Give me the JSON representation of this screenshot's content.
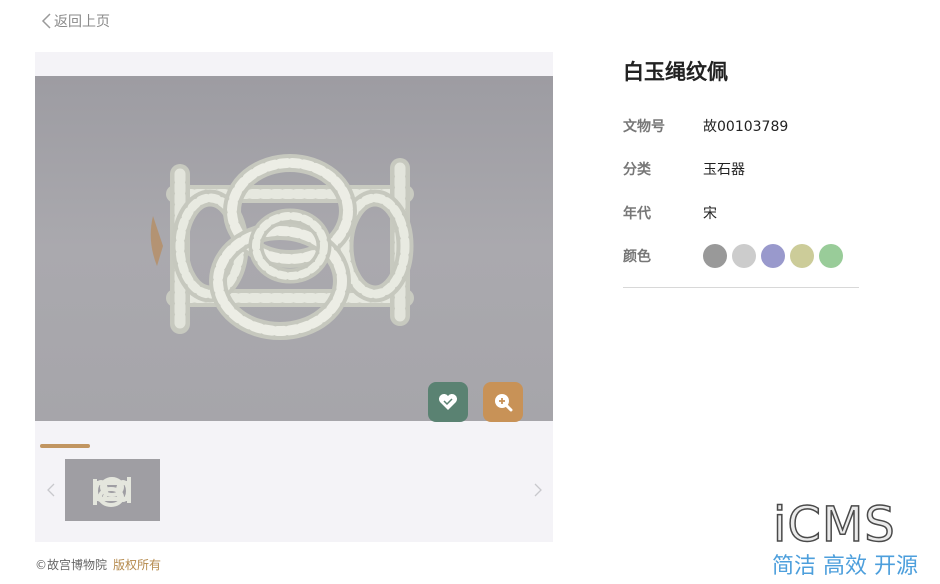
{
  "nav": {
    "back_label": "返回上页"
  },
  "artifact": {
    "title": "白玉绳纹佩",
    "fields": [
      {
        "label": "文物号",
        "value": "故00103789"
      },
      {
        "label": "分类",
        "value": "玉石器"
      },
      {
        "label": "年代",
        "value": "宋"
      }
    ],
    "color_label": "颜色",
    "colors": [
      "#999999",
      "#cccccc",
      "#9999cc",
      "#cccc99",
      "#99cc99"
    ]
  },
  "gallery": {
    "like_icon": "heart-icon",
    "zoom_icon": "zoom-in-icon",
    "accent_like": "#5a8272",
    "accent_zoom": "#c89257",
    "progress_color": "#c19561"
  },
  "footer": {
    "copyright": "©故宫博物院",
    "rights": "版权所有"
  },
  "brand": {
    "logo": "iCMS",
    "tagline": "简洁 高效 开源"
  }
}
